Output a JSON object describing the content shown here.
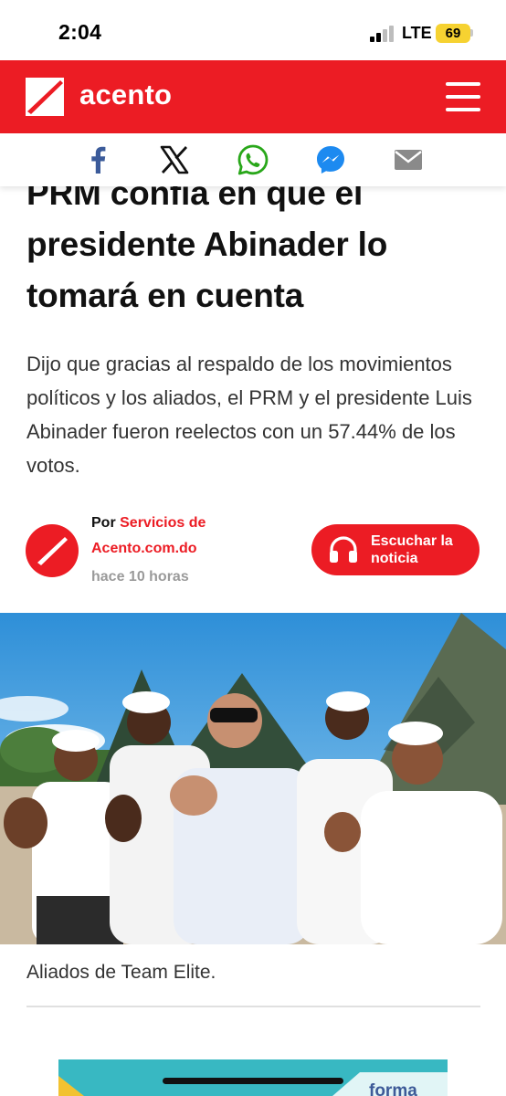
{
  "status_bar": {
    "time": "2:04",
    "network": "LTE",
    "battery": "69"
  },
  "header": {
    "logo_text": "acento",
    "brand_color": "#ec1c24"
  },
  "share_bar": {
    "icons": [
      "facebook-icon",
      "x-icon",
      "whatsapp-icon",
      "messenger-icon",
      "email-icon"
    ]
  },
  "article": {
    "headline_line1": "PRM confía en que el",
    "headline_line2": "presidente Abinader lo",
    "headline_line3": "tomará en cuenta",
    "summary": "Dijo que gracias al respaldo de los movimientos políticos y los aliados, el PRM y el presidente Luis Abinader fueron reelectos con un 57.44% de los votos.",
    "byline_prefix": "Por",
    "author": "Servicios de Acento.com.do",
    "timestamp": "hace 10 horas",
    "listen_label": "Escuchar la noticia",
    "image_caption": "Aliados de Team Elite."
  },
  "ad": {
    "text": "forma"
  }
}
